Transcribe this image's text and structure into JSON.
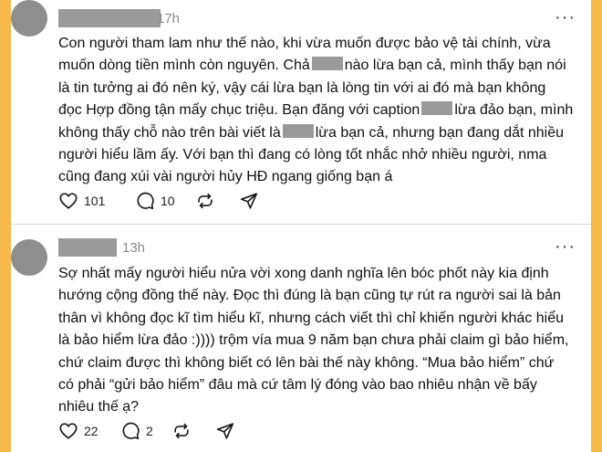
{
  "posts": [
    {
      "time": "17h",
      "more": "···",
      "lines": [
        "Con người tham lam như thế nào, khi vừa muốn được bảo vệ tài chính, vừa",
        "muốn dòng tiền mình còn nguyên. Chả",
        "nào lừa bạn cả, mình thấy bạn nói",
        "là tin tưởng ai đó nên ký, vậy cái lừa bạn là lòng tin với ai đó mà bạn không",
        "đọc Hợp đồng tận mấy chục triệu. Bạn đăng với caption",
        "lừa đảo bạn, mình",
        "không thấy chỗ nào trên bài viết là",
        "lừa bạn cả, nhưng bạn đang dắt nhiều",
        "người hiểu lầm ấy. Với bạn thì đang có lòng tốt nhắc nhở nhiều người, nma",
        "cũng đang xúi vài người hủy HĐ ngang giống bạn á"
      ],
      "likes": "101",
      "replies": "10"
    },
    {
      "time": "13h",
      "more": "···",
      "lines": [
        "Sợ nhất mấy người hiểu nửa vời xong danh nghĩa lên bóc phốt này kia định",
        "hướng cộng đồng thế này. Đọc thì đúng là bạn cũng tự rút ra người sai là bản",
        "thân vì không đọc kĩ tìm hiểu kĩ, nhưng cách viết thì chỉ khiến người khác hiểu",
        "là bảo hiểm lừa đảo :)))) trộm vía mua 9 năm bạn chưa phải claim gì bảo hiểm,",
        "chứ claim được thì không biết có lên bài thế này không. “Mua bảo hiểm” chứ",
        "có phải “gửi bảo hiểm” đâu mà cứ tâm lý đóng vào bao nhiêu nhận về bấy",
        "nhiêu thế ạ?"
      ],
      "likes": "22",
      "replies": "2"
    }
  ]
}
